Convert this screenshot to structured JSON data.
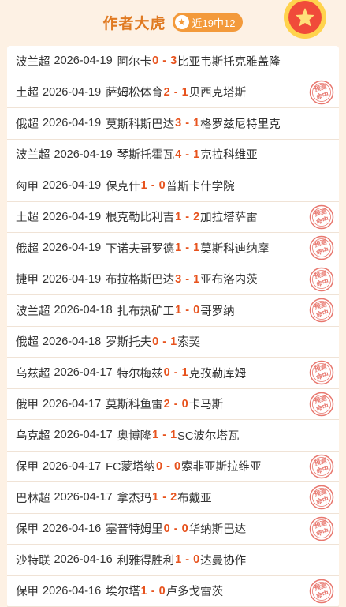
{
  "header": {
    "author": "作者大虎",
    "record": "近19中12"
  },
  "stamp_text": [
    "预测",
    "命中"
  ],
  "matches": [
    {
      "league": "波兰超",
      "date": "2026-04-19",
      "home": "阿尔卡",
      "home_score": "0",
      "away_score": "3",
      "away": "比亚韦斯托克雅盖隆",
      "hit": false
    },
    {
      "league": "土超",
      "date": "2026-04-19",
      "home": "萨姆松体育",
      "home_score": "2",
      "away_score": "1",
      "away": "贝西克塔斯",
      "hit": true
    },
    {
      "league": "俄超",
      "date": "2026-04-19",
      "home": "莫斯科斯巴达",
      "home_score": "3",
      "away_score": "1",
      "away": "格罗兹尼特里克",
      "hit": false
    },
    {
      "league": "波兰超",
      "date": "2026-04-19",
      "home": "琴斯托霍瓦",
      "home_score": "4",
      "away_score": "1",
      "away": "克拉科维亚",
      "hit": false
    },
    {
      "league": "匈甲",
      "date": "2026-04-19",
      "home": "保克什",
      "home_score": "1",
      "away_score": "0",
      "away": "普斯卡什学院",
      "hit": false
    },
    {
      "league": "土超",
      "date": "2026-04-19",
      "home": "根克勒比利吉",
      "home_score": "1",
      "away_score": "2",
      "away": "加拉塔萨雷",
      "hit": true
    },
    {
      "league": "俄超",
      "date": "2026-04-19",
      "home": "下诺夫哥罗德",
      "home_score": "1",
      "away_score": "1",
      "away": "莫斯科迪纳摩",
      "hit": true
    },
    {
      "league": "捷甲",
      "date": "2026-04-19",
      "home": "布拉格斯巴达",
      "home_score": "3",
      "away_score": "1",
      "away": "亚布洛内茨",
      "hit": true
    },
    {
      "league": "波兰超",
      "date": "2026-04-18",
      "home": "扎布热矿工",
      "home_score": "1",
      "away_score": "0",
      "away": "哥罗纳",
      "hit": true
    },
    {
      "league": "俄超",
      "date": "2026-04-18",
      "home": "罗斯托夫",
      "home_score": "0",
      "away_score": "1",
      "away": "索契",
      "hit": false
    },
    {
      "league": "乌兹超",
      "date": "2026-04-17",
      "home": "特尔梅兹",
      "home_score": "0",
      "away_score": "1",
      "away": "克孜勒库姆",
      "hit": true
    },
    {
      "league": "俄甲",
      "date": "2026-04-17",
      "home": "莫斯科鱼雷",
      "home_score": "2",
      "away_score": "0",
      "away": "卡马斯",
      "hit": true
    },
    {
      "league": "乌克超",
      "date": "2026-04-17",
      "home": "奥博隆",
      "home_score": "1",
      "away_score": "1",
      "away": "SC波尔塔瓦",
      "hit": false
    },
    {
      "league": "保甲",
      "date": "2026-04-17",
      "home": "FC蒙塔纳",
      "home_score": "0",
      "away_score": "0",
      "away": "索非亚斯拉维亚",
      "hit": true
    },
    {
      "league": "巴林超",
      "date": "2026-04-17",
      "home": "拿杰玛",
      "home_score": "1",
      "away_score": "2",
      "away": "布戴亚",
      "hit": true
    },
    {
      "league": "保甲",
      "date": "2026-04-16",
      "home": "塞普特姆里",
      "home_score": "0",
      "away_score": "0",
      "away": "华纳斯巴达",
      "hit": true
    },
    {
      "league": "沙特联",
      "date": "2026-04-16",
      "home": "利雅得胜利",
      "home_score": "1",
      "away_score": "0",
      "away": "达曼协作",
      "hit": false
    },
    {
      "league": "保甲",
      "date": "2026-04-16",
      "home": "埃尔塔",
      "home_score": "1",
      "away_score": "0",
      "away": "卢多戈雷茨",
      "hit": true
    }
  ]
}
